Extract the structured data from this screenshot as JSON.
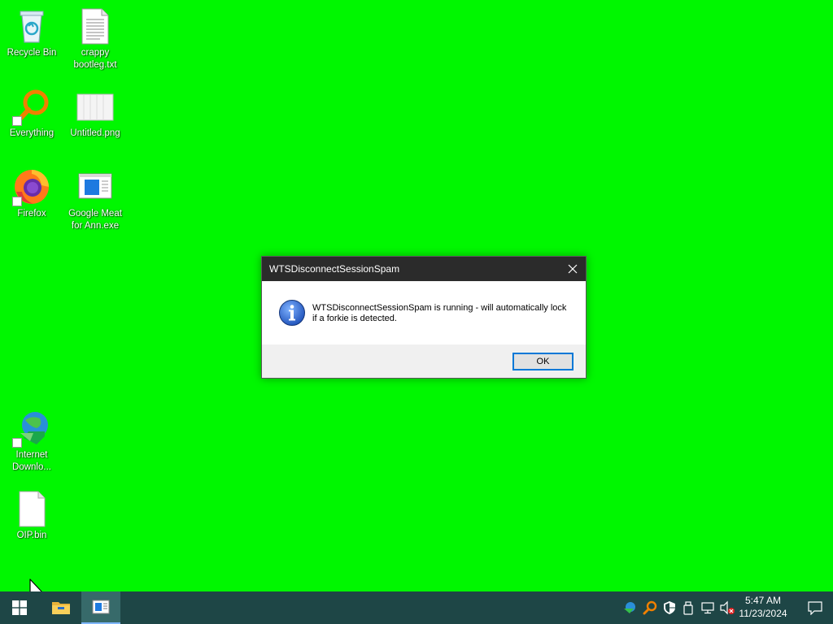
{
  "desktop": {
    "background_color": "#00f700",
    "icons": [
      {
        "label": "Recycle Bin",
        "icon": "recycle-bin-icon"
      },
      {
        "label": "crappy bootleg.txt",
        "icon": "text-file-icon"
      },
      {
        "label": "Everything",
        "icon": "everything-search-icon"
      },
      {
        "label": "Untitled.png",
        "icon": "image-file-icon"
      },
      {
        "label": "Firefox",
        "icon": "firefox-icon"
      },
      {
        "label": "Google Meat for Ann.exe",
        "icon": "exe-window-icon"
      },
      {
        "label": "Internet Downlo...",
        "icon": "internet-download-manager-icon"
      },
      {
        "label": "OIP.bin",
        "icon": "blank-file-icon"
      }
    ]
  },
  "dialog": {
    "title": "WTSDisconnectSessionSpam",
    "message": "WTSDisconnectSessionSpam is running - will automatically lock if a forkie is detected.",
    "ok_label": "OK",
    "icon": "info-icon"
  },
  "taskbar": {
    "color": "#1e4646",
    "clock_time": "5:47 AM",
    "clock_date": "11/23/2024"
  }
}
